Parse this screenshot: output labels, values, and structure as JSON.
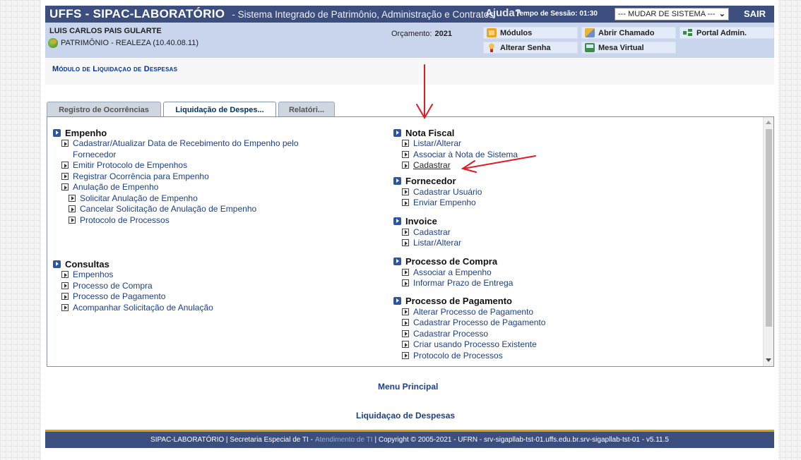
{
  "header": {
    "system_title": "UFFS - SIPAC-LABORATÓRIO",
    "system_subtitle": "- Sistema Integrado de Patrimônio, Administração e Contratos",
    "help_label": "Ajuda?",
    "session_label": "Tempo de Sessão: 01:30",
    "system_select_value": "--- MUDAR DE SISTEMA ---",
    "logout_label": "SAIR"
  },
  "user": {
    "name": "LUIS CARLOS PAIS GULARTE",
    "unit": "PATRIMÔNIO - REALEZA (10.40.08.11)",
    "budget_label": "Orçamento:",
    "budget_year": "2021"
  },
  "quick_links": {
    "modulos": "Módulos",
    "abrir_chamado": "Abrir Chamado",
    "portal_admin": "Portal Admin.",
    "alterar_senha": "Alterar Senha",
    "mesa_virtual": "Mesa Virtual"
  },
  "module_title": "Módulo de Liquidaçao de Despesas",
  "tabs": [
    {
      "label": "Registro de Ocorrências"
    },
    {
      "label": "Liquidação de Despes..."
    },
    {
      "label": "Relatóri..."
    }
  ],
  "left_sections": {
    "empenho": {
      "title": "Empenho",
      "items": [
        "Cadastrar/Atualizar Data de Recebimento do Empenho pelo",
        "Fornecedor",
        "Emitir Protocolo de Empenhos",
        "Registrar Ocorrência para Empenho",
        "Anulação de Empenho"
      ],
      "sub_items": [
        "Solicitar Anulação de Empenho",
        "Cancelar Solicitação de Anulação de Empenho",
        "Protocolo de Processos"
      ]
    },
    "consultas": {
      "title": "Consultas",
      "items": [
        "Empenhos",
        "Processo de Compra",
        "Processo de Pagamento",
        "Acompanhar Solicitação de Anulação"
      ]
    }
  },
  "right_sections": {
    "nota_fiscal": {
      "title": "Nota Fiscal",
      "items": [
        "Listar/Alterar",
        "Associar à Nota de Sistema",
        "Cadastrar"
      ]
    },
    "fornecedor": {
      "title": "Fornecedor",
      "items": [
        "Cadastrar Usuário",
        "Enviar Empenho"
      ]
    },
    "invoice": {
      "title": "Invoice",
      "items": [
        "Cadastrar",
        "Listar/Alterar"
      ]
    },
    "processo_compra": {
      "title": "Processo de Compra",
      "items": [
        "Associar a Empenho",
        "Informar Prazo de Entrega"
      ]
    },
    "processo_pagamento": {
      "title": "Processo de Pagamento",
      "items": [
        "Alterar Processo de Pagamento",
        "Cadastrar Processo de Pagamento",
        "Cadastrar Processo",
        "Criar usando Processo Existente",
        "Protocolo de Processos"
      ]
    }
  },
  "bottom_links": {
    "menu_principal": "Menu Principal",
    "liquidacao": "Liquidaçao de Despesas"
  },
  "footer": {
    "part1": "SIPAC-LABORATÓRIO | Secretaria Especial de TI -",
    "link": "Atendimento de TI",
    "part2": "| Copyright © 2005-2021 - UFRN - srv-sigapllab-tst-01.uffs.edu.br.srv-sigapllab-tst-01 - v5.11.5"
  },
  "colors": {
    "header_bg": "#3c4e7e",
    "annotation_red": "#e01b24",
    "link_blue": "#1c3f8a"
  }
}
